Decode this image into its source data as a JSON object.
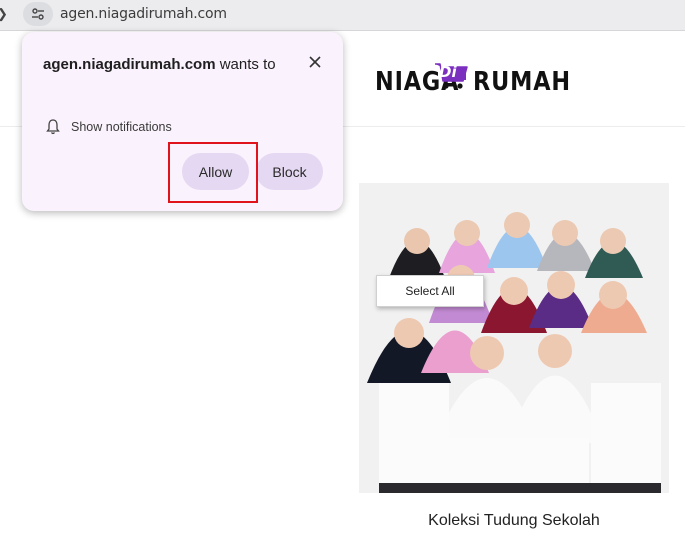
{
  "browser": {
    "url": "agen.niagadirumah.com",
    "back_icon": "back-arrow-icon",
    "site_info_icon": "tune-icon"
  },
  "site": {
    "logo_left": "NIAGA",
    "logo_middle": "Di",
    "logo_right": "RUMAH",
    "logo_accent_color": "#7b2fbf"
  },
  "popup": {
    "site_name": "agen.niagadirumah.com",
    "wants_text": "wants to",
    "permission_label": "Show notifications",
    "allow_label": "Allow",
    "block_label": "Block",
    "close_icon": "close-icon",
    "bell_icon": "bell-icon",
    "background_color": "#faf2fc",
    "button_color": "#e5d8f2",
    "highlight_color": "#e0121b"
  },
  "product": {
    "title": "Koleksi Tudung Sekolah",
    "image_desc": "product-photo"
  },
  "context_menu": {
    "item": "Select All"
  }
}
